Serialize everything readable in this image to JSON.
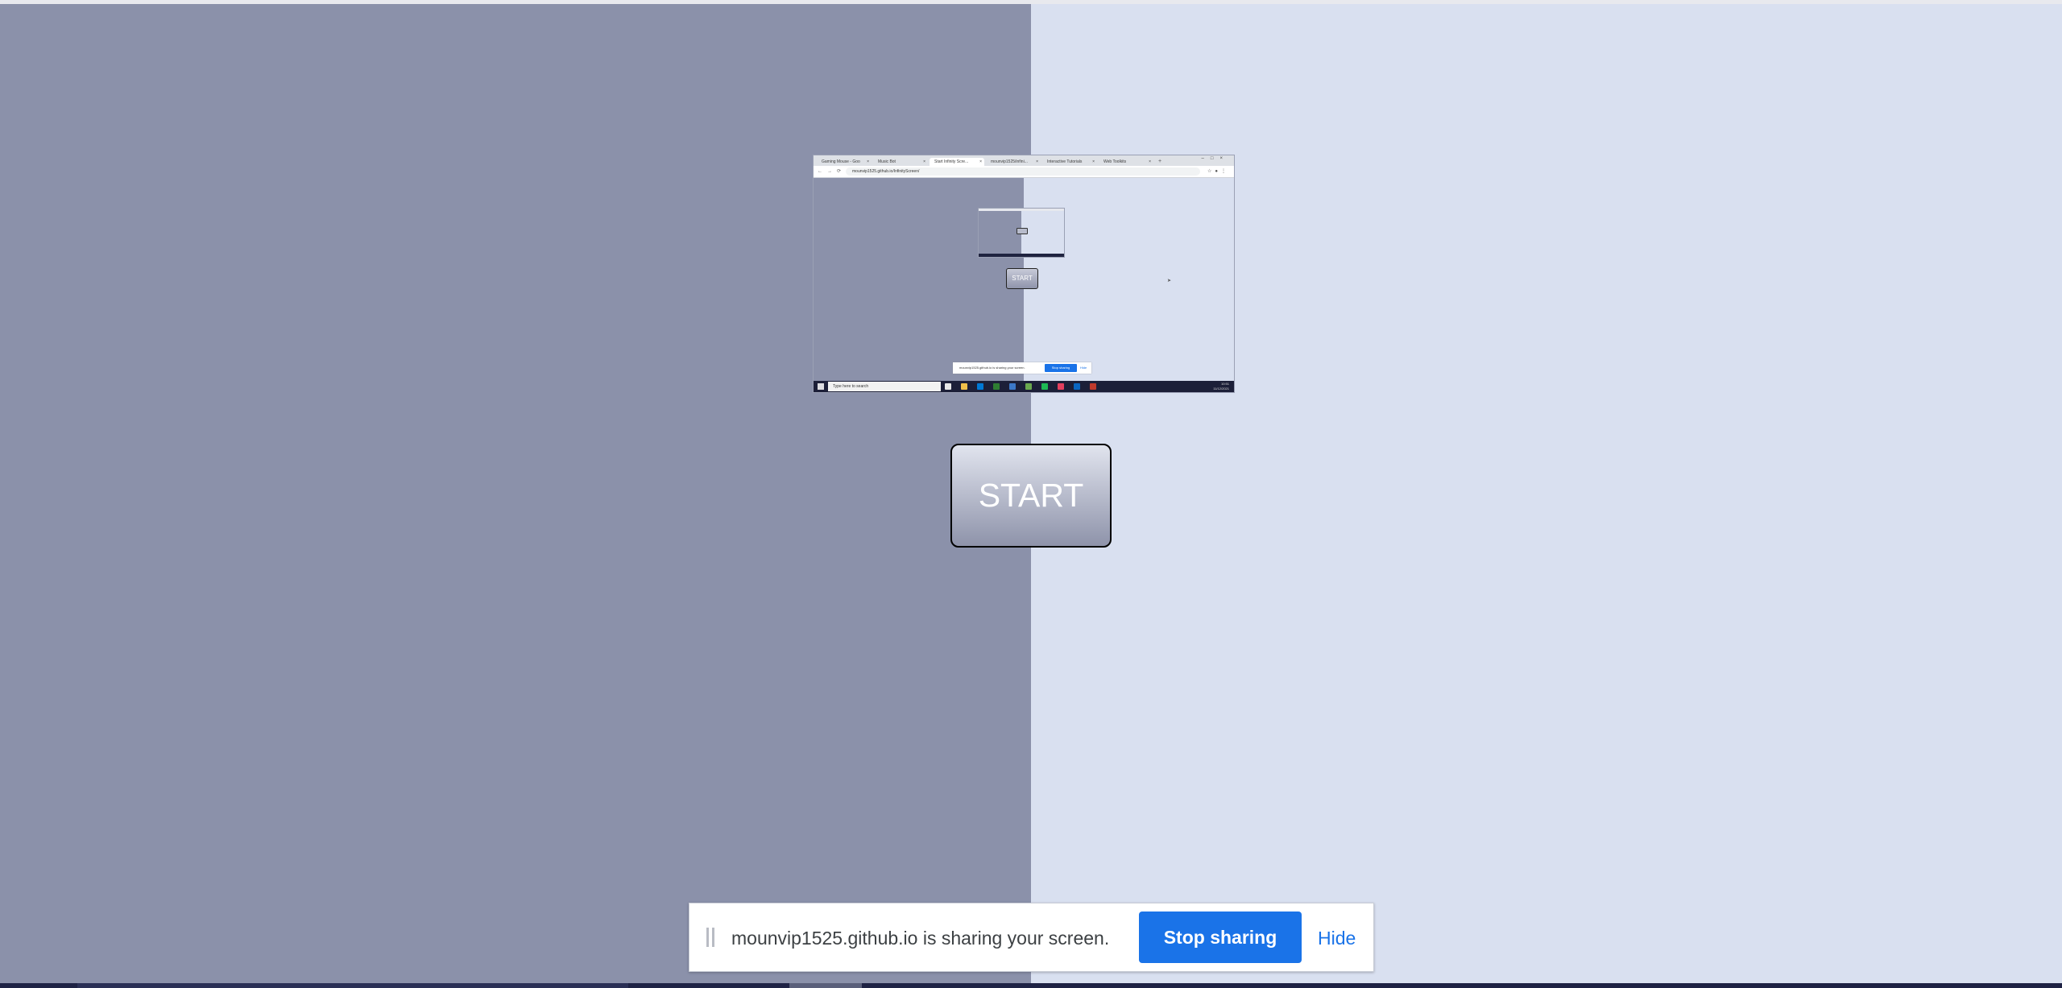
{
  "preview": {
    "tabs": [
      {
        "label": "Gaming Mouse - Goo",
        "active": false
      },
      {
        "label": "Music Bot",
        "active": false
      },
      {
        "label": "Start Infinity Scre...",
        "active": true
      },
      {
        "label": "mounvip1525/infini...",
        "active": false
      },
      {
        "label": "Interactive Tutorials",
        "active": false
      },
      {
        "label": "Web Toolkits",
        "active": false
      }
    ],
    "url": "mounvip1525.github.io/InfinityScreen/",
    "start_label": "START",
    "share_text": "mounvip1525.github.io is sharing your screen.",
    "stop_label": "Stop sharing",
    "hide_label": "Hide",
    "search_placeholder": "Type here to search",
    "tray_time": "10:51",
    "tray_date": "11/12/2021",
    "app_colors": [
      "#e8e8e8",
      "#f0c04a",
      "#0078d4",
      "#2e7d32",
      "#3c78c8",
      "#6aa84f",
      "#1db954",
      "#e4405f",
      "#0a66c2",
      "#c0392b"
    ]
  },
  "main": {
    "start_label": "START"
  },
  "share_bar": {
    "message": "mounvip1525.github.io is sharing your screen.",
    "stop_label": "Stop sharing",
    "hide_label": "Hide"
  },
  "colors": {
    "left_panel": "#8b91aa",
    "right_panel": "#d9e0f0",
    "accent": "#1a73e8"
  }
}
